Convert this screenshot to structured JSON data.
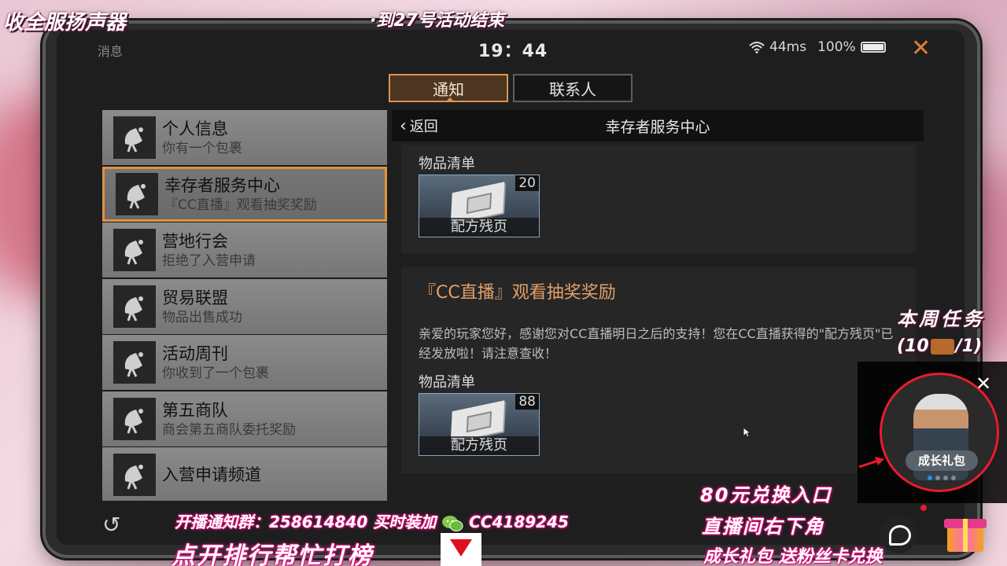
{
  "status_bar": {
    "app_name": "消息",
    "time": "19：44",
    "network": "44ms",
    "battery": "100%"
  },
  "tabs": [
    {
      "label": "通知",
      "active": true
    },
    {
      "label": "联系人",
      "active": false
    }
  ],
  "messages": [
    {
      "title": "个人信息",
      "subtitle": "你有一个包裹"
    },
    {
      "title": "幸存者服务中心",
      "subtitle": "『CC直播』观看抽奖奖励",
      "active": true
    },
    {
      "title": "营地行会",
      "subtitle": "拒绝了入营申请"
    },
    {
      "title": "贸易联盟",
      "subtitle": "物品出售成功"
    },
    {
      "title": "活动周刊",
      "subtitle": "你收到了一个包裹"
    },
    {
      "title": "第五商队",
      "subtitle": "商会第五商队委托奖励"
    },
    {
      "title": "入营申请频道",
      "subtitle": ""
    }
  ],
  "detail": {
    "back_label": "返回",
    "title": "幸存者服务中心",
    "card1": {
      "items_label": "物品清单",
      "item": {
        "name": "配方残页",
        "count": "20"
      }
    },
    "card2": {
      "heading": "『CC直播』观看抽奖奖励",
      "body": "亲爱的玩家您好，感谢您对CC直播明日之后的支持！您在CC直播获得的\"配方残页\"已经发放啦！请注意查收！",
      "items_label": "物品清单",
      "item": {
        "name": "配方残页",
        "count": "88"
      }
    }
  },
  "overlays": {
    "top_left": "收全服扬声器",
    "top_center": "·到27号活动结束",
    "weekly_task_title": "本周任务",
    "weekly_task_progress": "(10",
    "weekly_task_progress_end": "/1)",
    "bottom_line1_a": "开播通知群：258614840 买时装加",
    "bottom_line1_b": "CC4189245",
    "bottom_line2": "点开排行帮忙打榜",
    "right_line1": "80元兑换入口",
    "right_line2": "直播间右下角",
    "right_line3": "成长礼包 送粉丝卡兑换",
    "promo_label": "成长礼包"
  },
  "colors": {
    "accent_orange": "#e1923f",
    "highlight_text": "#e3a069",
    "promo_red": "#e81c2c"
  }
}
